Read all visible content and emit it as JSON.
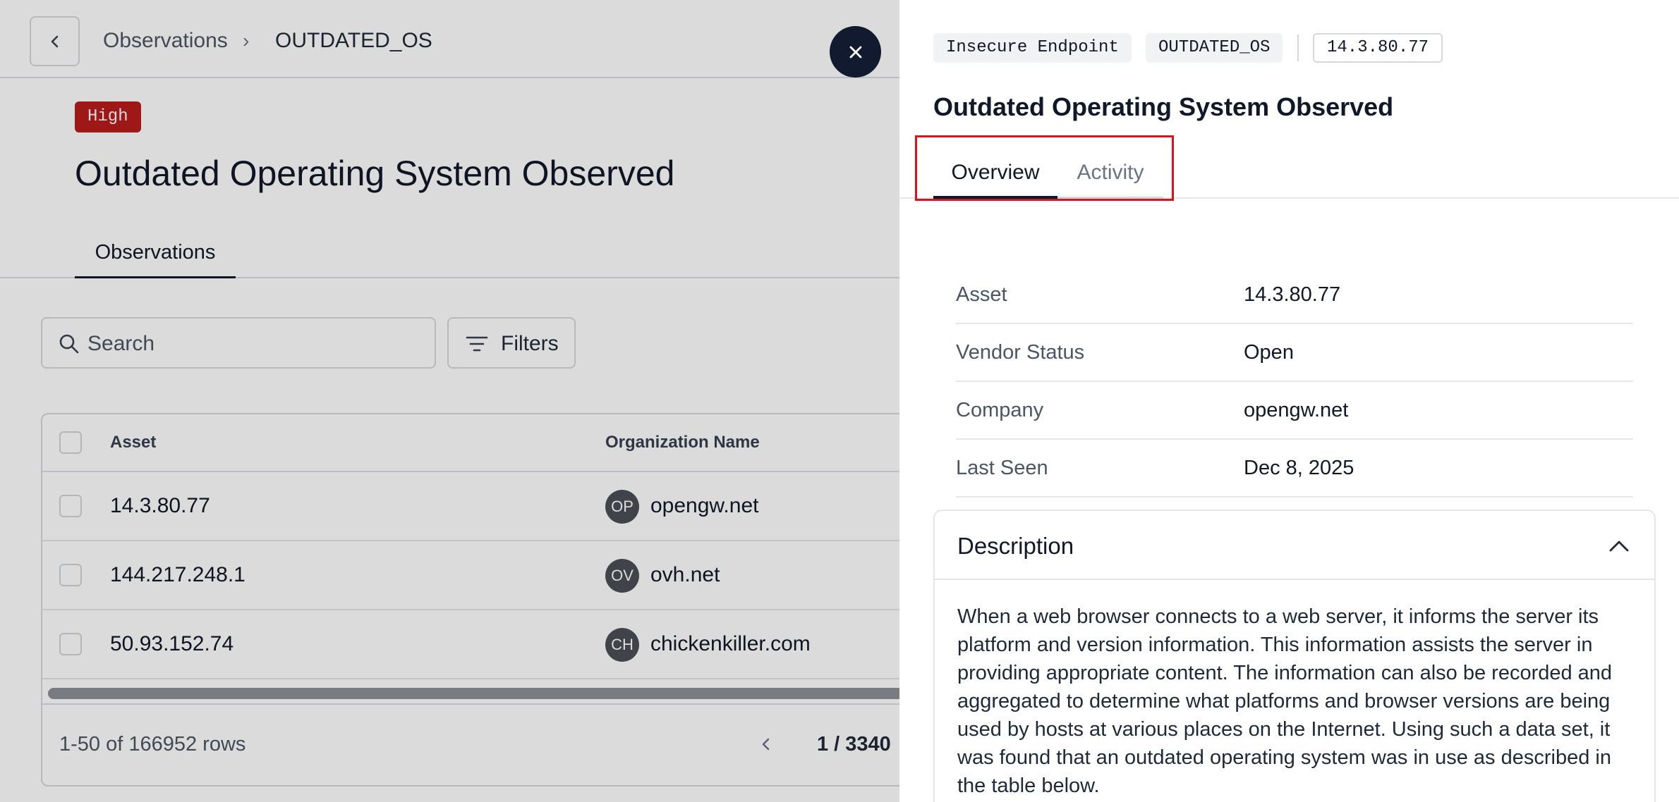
{
  "breadcrumb": {
    "parent": "Observations",
    "separator": "›",
    "current": "OUTDATED_OS"
  },
  "page": {
    "severity": "High",
    "title": "Outdated Operating System Observed",
    "tab": "Observations"
  },
  "toolbar": {
    "search_placeholder": "Search",
    "filters_label": "Filters"
  },
  "table": {
    "headers": {
      "asset": "Asset",
      "organization": "Organization Name"
    },
    "rows": [
      {
        "asset": "14.3.80.77",
        "initials": "OP",
        "org": "opengw.net"
      },
      {
        "asset": "144.217.248.1",
        "initials": "OV",
        "org": "ovh.net"
      },
      {
        "asset": "50.93.152.74",
        "initials": "CH",
        "org": "chickenkiller.com"
      }
    ],
    "row_count": "1-50 of 166952 rows",
    "page_info": "1 / 3340"
  },
  "drawer": {
    "tags": [
      "Insecure Endpoint",
      "OUTDATED_OS",
      "14.3.80.77"
    ],
    "title": "Outdated Operating System Observed",
    "tabs": [
      "Overview",
      "Activity"
    ],
    "details": [
      {
        "label": "Asset",
        "value": "14.3.80.77"
      },
      {
        "label": "Vendor Status",
        "value": "Open"
      },
      {
        "label": "Company",
        "value": "opengw.net"
      },
      {
        "label": "Last Seen",
        "value": "Dec 8, 2025"
      }
    ],
    "description": {
      "title": "Description",
      "text": "When a web browser connects to a web server, it informs the server its platform and version information. This information assists the server in providing appropriate content. The information can also be recorded and aggregated to determine what platforms and browser versions are being used by hosts at various places on the Internet. Using such a data set, it was found that an outdated operating system was in use as described in the table below."
    }
  },
  "colors": {
    "severity_high": "#b91c1c",
    "close_button": "#111a2e",
    "highlight": "#e0101c"
  },
  "icons": {
    "back": "chevron-left-icon",
    "close": "close-icon",
    "search": "search-icon",
    "filters": "filter-lines-icon",
    "prev_page": "chevron-left-icon",
    "collapse": "chevron-up-icon"
  }
}
